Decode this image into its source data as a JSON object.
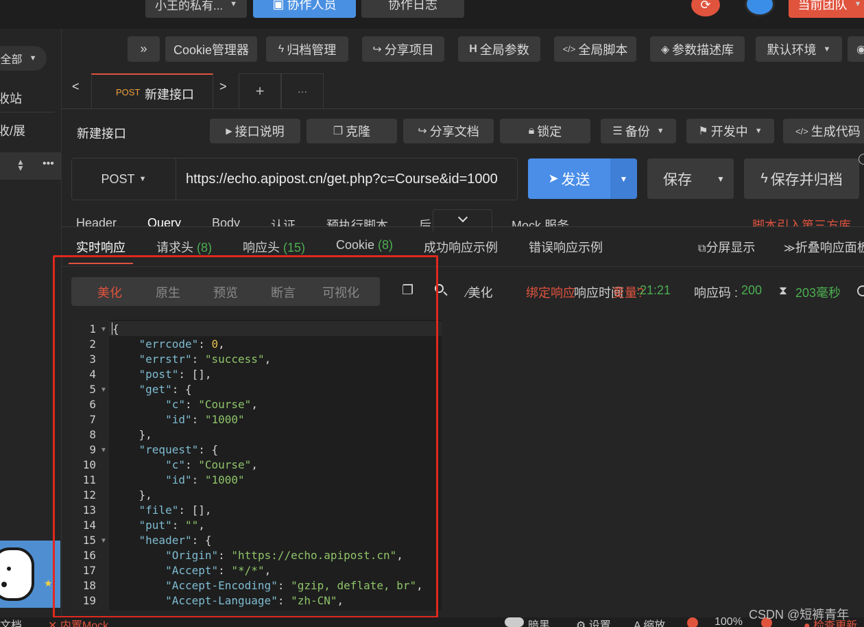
{
  "topbar": {
    "project": "小王的私有...",
    "collab_button": "协作人员",
    "collab_log": "协作日志",
    "team_button": "当前团队"
  },
  "sidebar": {
    "filter": "全部",
    "recycle": "收站",
    "collapse": "收/展"
  },
  "toolbar": {
    "expand": "»",
    "cookie": "Cookie管理器",
    "archive": "归档管理",
    "share_project": "分享项目",
    "global_params": "全局参数",
    "global_script": "全局脚本",
    "param_lib": "参数描述库",
    "env": "默认环境"
  },
  "tabs": {
    "method": "POST",
    "title": "新建接口",
    "add": "+",
    "more": "···"
  },
  "api": {
    "name": "新建接口",
    "doc": "接口说明",
    "clone": "克隆",
    "share_doc": "分享文档",
    "lock": "锁定",
    "backup": "备份",
    "status": "开发中",
    "gen_code": "生成代码"
  },
  "request": {
    "method": "POST",
    "url": "https://echo.apipost.cn/get.php?c=Course&id=1000",
    "send": "发送",
    "save": "保存",
    "save_archive": "保存并归档"
  },
  "req_tabs": [
    "Header",
    "Query",
    "Body",
    "认证",
    "预执行脚本",
    "后",
    "Mock 服务"
  ],
  "req_hint": "脚本引入第三方库",
  "resp_tabs": {
    "live": "实时响应",
    "req_headers": "请求头",
    "req_headers_count": "(8)",
    "resp_headers": "响应头",
    "resp_headers_count": "(15)",
    "cookie": "Cookie",
    "cookie_count": "(8)",
    "success_example": "成功响应示例",
    "error_example": "错误响应示例",
    "split": "分屏显示",
    "fold": "折叠响应面板"
  },
  "view_tabs": [
    "美化",
    "原生",
    "预览",
    "断言",
    "可视化"
  ],
  "resp_tools": {
    "beautify": "美化",
    "bind": "绑定响应",
    "resp_time_label": "响应时间",
    "overlap": "变量?",
    "time": ":21:21",
    "code_label": "响应码 :",
    "code": "200",
    "duration": "203毫秒"
  },
  "code_lines": [
    "{",
    "    \"errcode\": 0,",
    "    \"errstr\": \"success\",",
    "    \"post\": [],",
    "    \"get\": {",
    "        \"c\": \"Course\",",
    "        \"id\": \"1000\"",
    "    },",
    "    \"request\": {",
    "        \"c\": \"Course\",",
    "        \"id\": \"1000\"",
    "    },",
    "    \"file\": [],",
    "    \"put\": \"\",",
    "    \"header\": {",
    "        \"Origin\": \"https://echo.apipost.cn\",",
    "        \"Accept\": \"*/*\",",
    "        \"Accept-Encoding\": \"gzip, deflate, br\",",
    "        \"Accept-Language\": \"zh-CN\","
  ],
  "fold_lines": [
    1,
    5,
    9,
    15
  ],
  "bottom": {
    "doc": "文档",
    "mock": "内置Mock",
    "watermark": "CSDN @短裤青年",
    "dark": "暗黑",
    "settings": "设置",
    "zoom": "缩放",
    "zoom_value": "100%",
    "update": "检查更新"
  },
  "colors": {
    "accent_blue": "#4a90e2",
    "send_blue": "#4a8ee8",
    "team_red": "#e0533d",
    "annotation_red": "#e0281e",
    "count_green": "#4caf50"
  }
}
